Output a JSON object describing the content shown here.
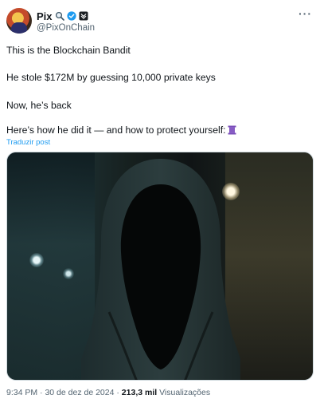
{
  "author": {
    "name": "Pix",
    "handle": "@PixOnChain"
  },
  "post": {
    "lines": [
      "This is the Blockchain Bandit",
      "He stole $172M by guessing 10,000 private keys",
      "Now, he’s back",
      "Here’s how he did it — and how to protect yourself:"
    ],
    "translate_link": "Traduzir post"
  },
  "footer": {
    "time": "9:34 PM",
    "sep1": "·",
    "date": "30 de dez de 2024",
    "sep2": "·",
    "views_count": "213,3 mil",
    "views_label": "Visualizações"
  },
  "icons": {
    "magnifier": "magnifier-icon",
    "verified": "verified-badge-icon",
    "affiliate": "affiliate-badge-icon",
    "more": "more-icon",
    "thread": "thread-spool-icon"
  },
  "colors": {
    "link": "#1d9bf0",
    "verified": "#1d9bf0",
    "secondary_text": "#536471"
  }
}
